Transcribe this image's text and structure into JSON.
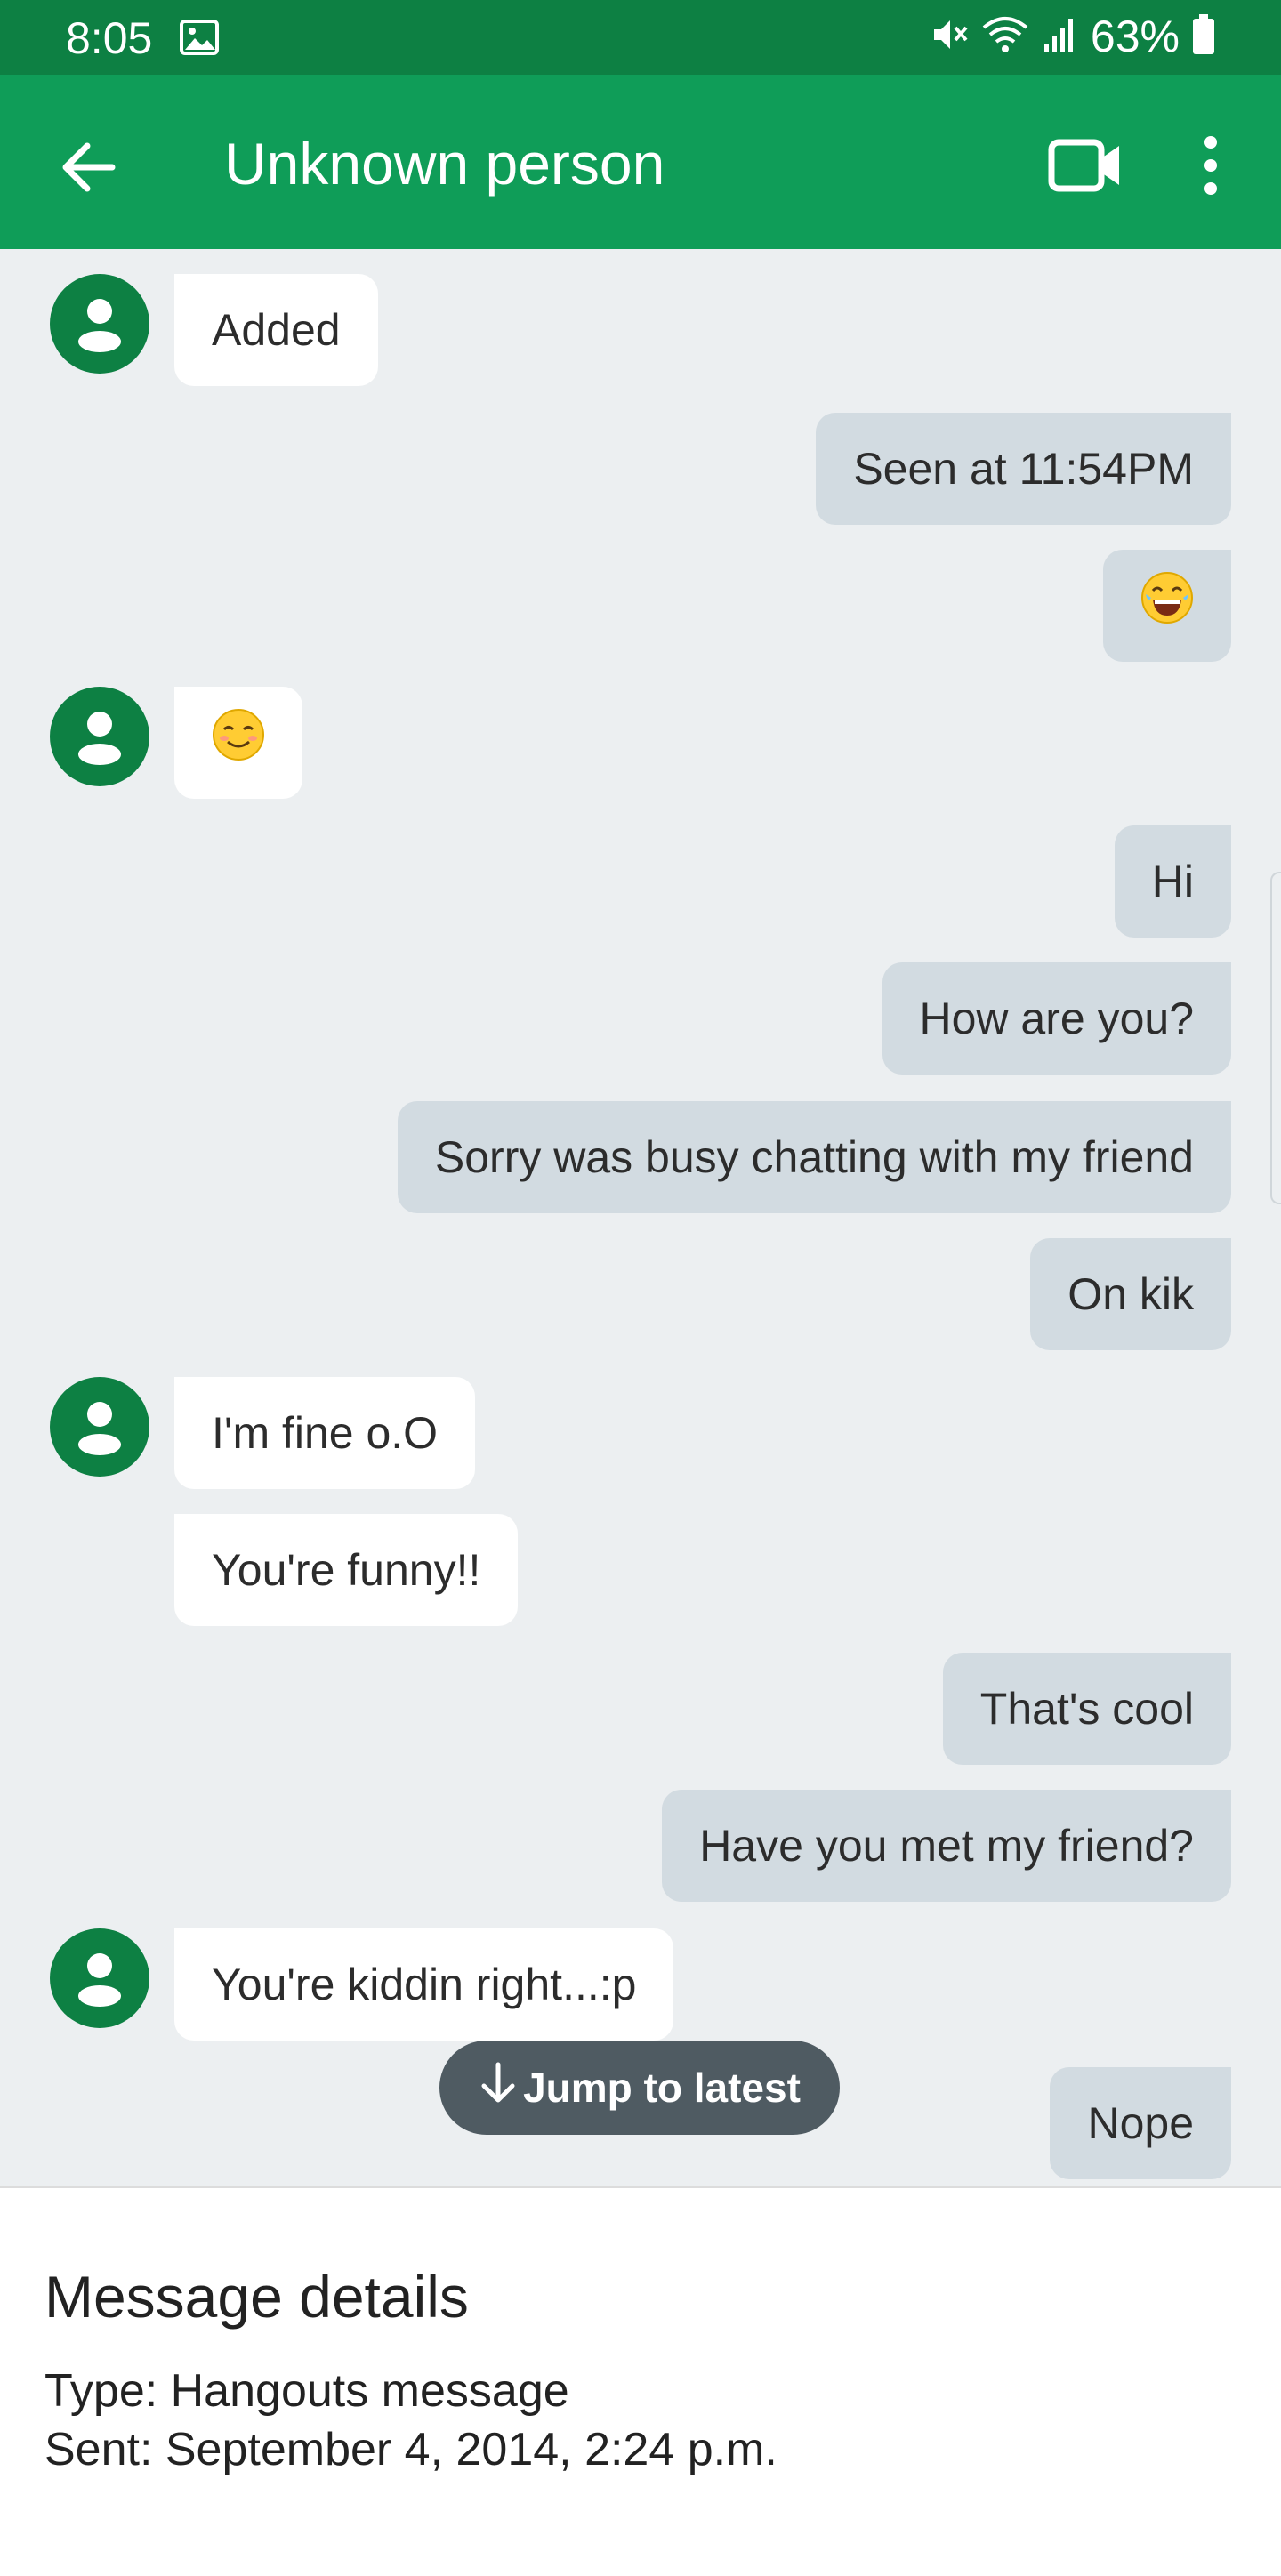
{
  "status_bar": {
    "time": "8:05",
    "battery": "63%"
  },
  "header": {
    "title": "Unknown person"
  },
  "messages": {
    "m1": "Added",
    "m2": "Seen at 11:54PM",
    "m5": "Hi",
    "m6": "How are you?",
    "m7": "Sorry was busy chatting with my friend",
    "m8": "On kik",
    "m9": "I'm fine o.O",
    "m10": "You're funny!!",
    "m11": "That's cool",
    "m12": "Have you met my friend?",
    "m13": "You're kiddin right...:p",
    "m14": "Nope"
  },
  "jump": {
    "label": "Jump to latest"
  },
  "details": {
    "title": "Message details",
    "type_line": "Type: Hangouts message",
    "sent_line": "Sent: September 4, 2014, 2:24 p.m."
  },
  "colors": {
    "status_bar": "#0d8043",
    "app_bar": "#0f9d58",
    "incoming_bubble": "#ffffff",
    "outgoing_bubble": "#d2dbe1",
    "chat_background": "#eceff1",
    "jump_button": "#4f5b62"
  },
  "icons": [
    "photo-icon",
    "mute-icon",
    "wifi-icon",
    "signal-icon",
    "battery-icon",
    "back-arrow-icon",
    "video-call-icon",
    "more-vert-icon",
    "person-icon",
    "laughing-emoji-icon",
    "smiling-emoji-icon",
    "arrow-down-icon"
  ]
}
